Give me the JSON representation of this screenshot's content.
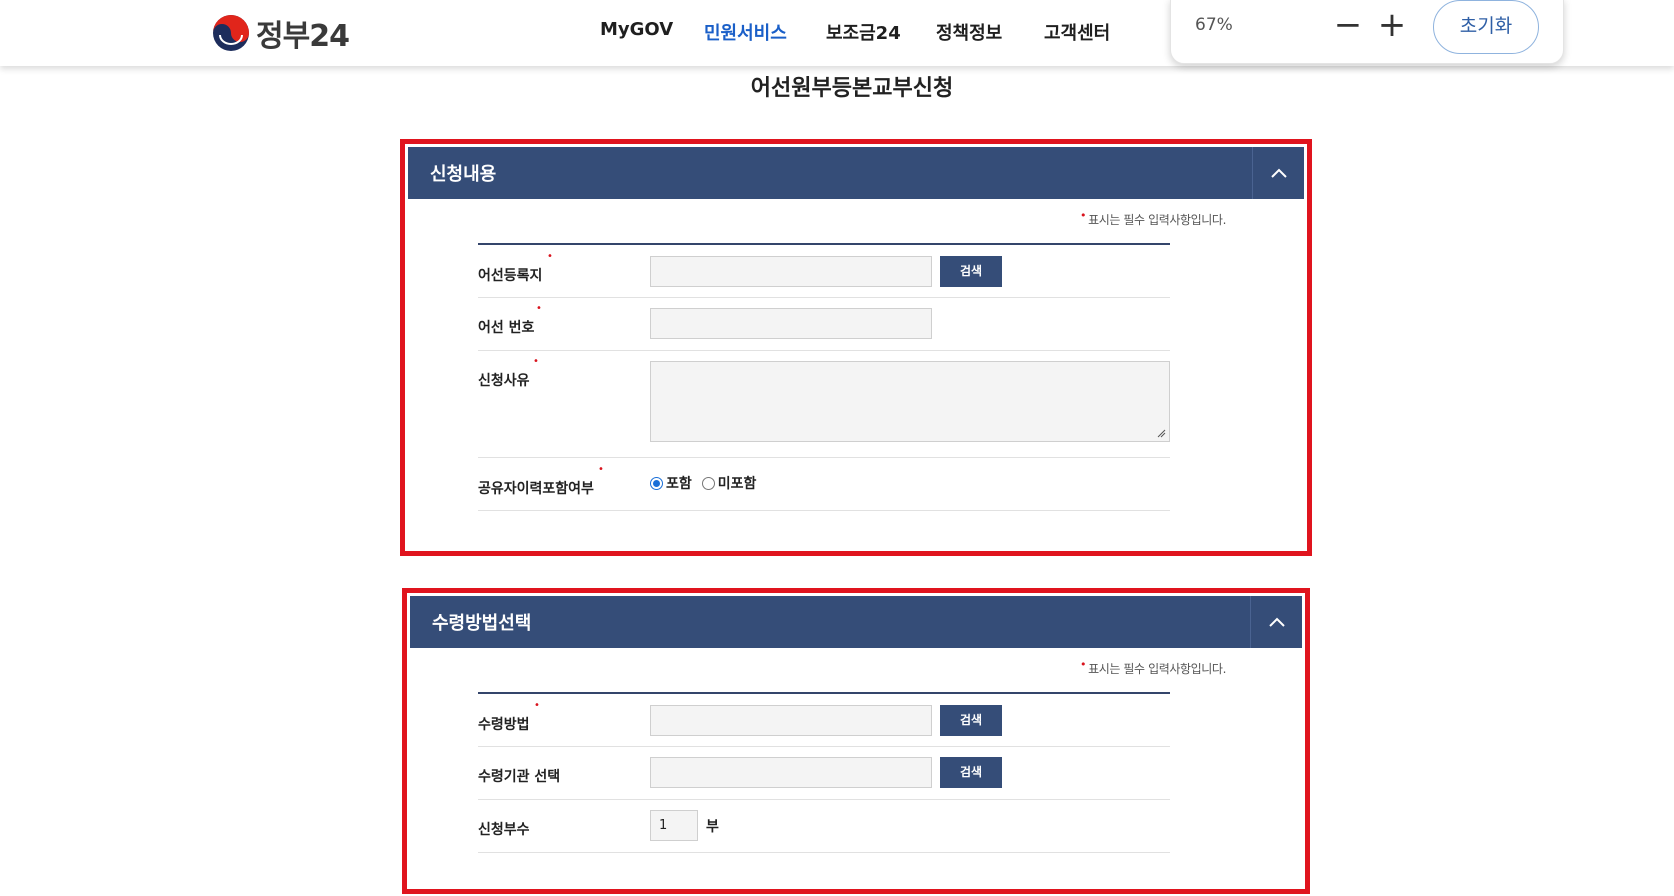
{
  "header": {
    "logo_text": "정부24",
    "nav": [
      "MyGOV",
      "민원서비스",
      "보조금24",
      "정책정보",
      "고객센터"
    ],
    "active_nav": "민원서비스"
  },
  "zoom": {
    "level": "67%",
    "minus": "−",
    "plus": "+",
    "reset_label": "초기화"
  },
  "page_title": "어선원부등본교부신청",
  "required_note": "표시는 필수 입력사항입니다.",
  "required_mark": "•",
  "section1": {
    "title": "신청내용",
    "fields": {
      "registry_label": "어선등록지",
      "boat_number_label": "어선 번호",
      "reason_label": "신청사유",
      "co_owner_label": "공유자이력포함여부"
    },
    "search_label": "검색",
    "radio_include": "포함",
    "radio_exclude": "미포함",
    "selected": "포함"
  },
  "section2": {
    "title": "수령방법선택",
    "fields": {
      "method_label": "수령방법",
      "agency_label": "수령기관 선택",
      "copies_label": "신청부수"
    },
    "search_label": "검색",
    "copies_value": "1",
    "copies_unit": "부"
  }
}
